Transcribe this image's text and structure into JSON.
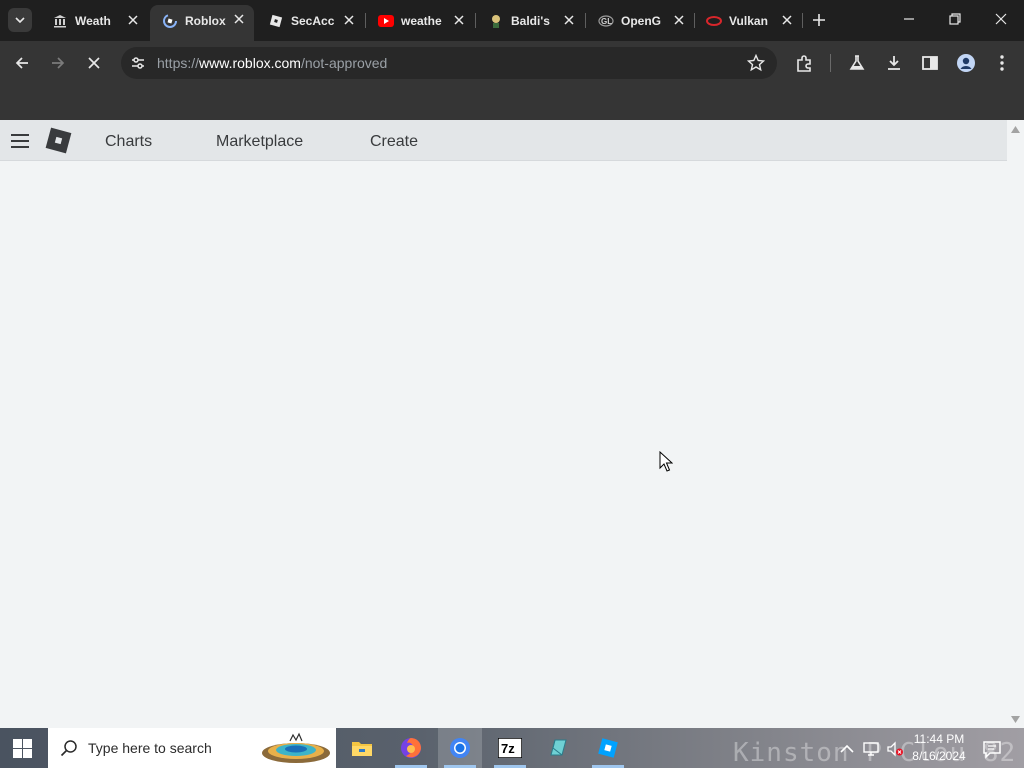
{
  "browser": {
    "tabs": [
      {
        "title": "Weath",
        "icon": "museum-icon",
        "active": false
      },
      {
        "title": "Roblox",
        "icon": "roblox-loading-icon",
        "active": true
      },
      {
        "title": "SecAcc",
        "icon": "roblox-icon",
        "active": false
      },
      {
        "title": "weathe",
        "icon": "youtube-icon",
        "active": false
      },
      {
        "title": "Baldi's",
        "icon": "baldi-icon",
        "active": false
      },
      {
        "title": "OpenG",
        "icon": "opengl-icon",
        "active": false
      },
      {
        "title": "Vulkan",
        "icon": "vulkan-icon",
        "active": false
      }
    ],
    "url_prefix": "https://",
    "url_host": "www.roblox.com",
    "url_path": "/not-approved"
  },
  "page": {
    "nav": {
      "charts": "Charts",
      "marketplace": "Marketplace",
      "create": "Create"
    }
  },
  "taskbar": {
    "search_placeholder": "Type here to search",
    "time": "11:44 PM",
    "date": "8/16/2024",
    "wallpaper_text": "Kinston  P Clou    82 P",
    "apps": [
      "file-explorer-icon",
      "firefox-icon",
      "chrome-icon",
      "7zip-icon",
      "app-icon",
      "roblox-studio-icon"
    ]
  },
  "colors": {
    "page_background": "#f2f4f5",
    "header_background": "#e3e6e8",
    "browser_dark": "#353535",
    "tabstrip": "#1f1f1f"
  }
}
